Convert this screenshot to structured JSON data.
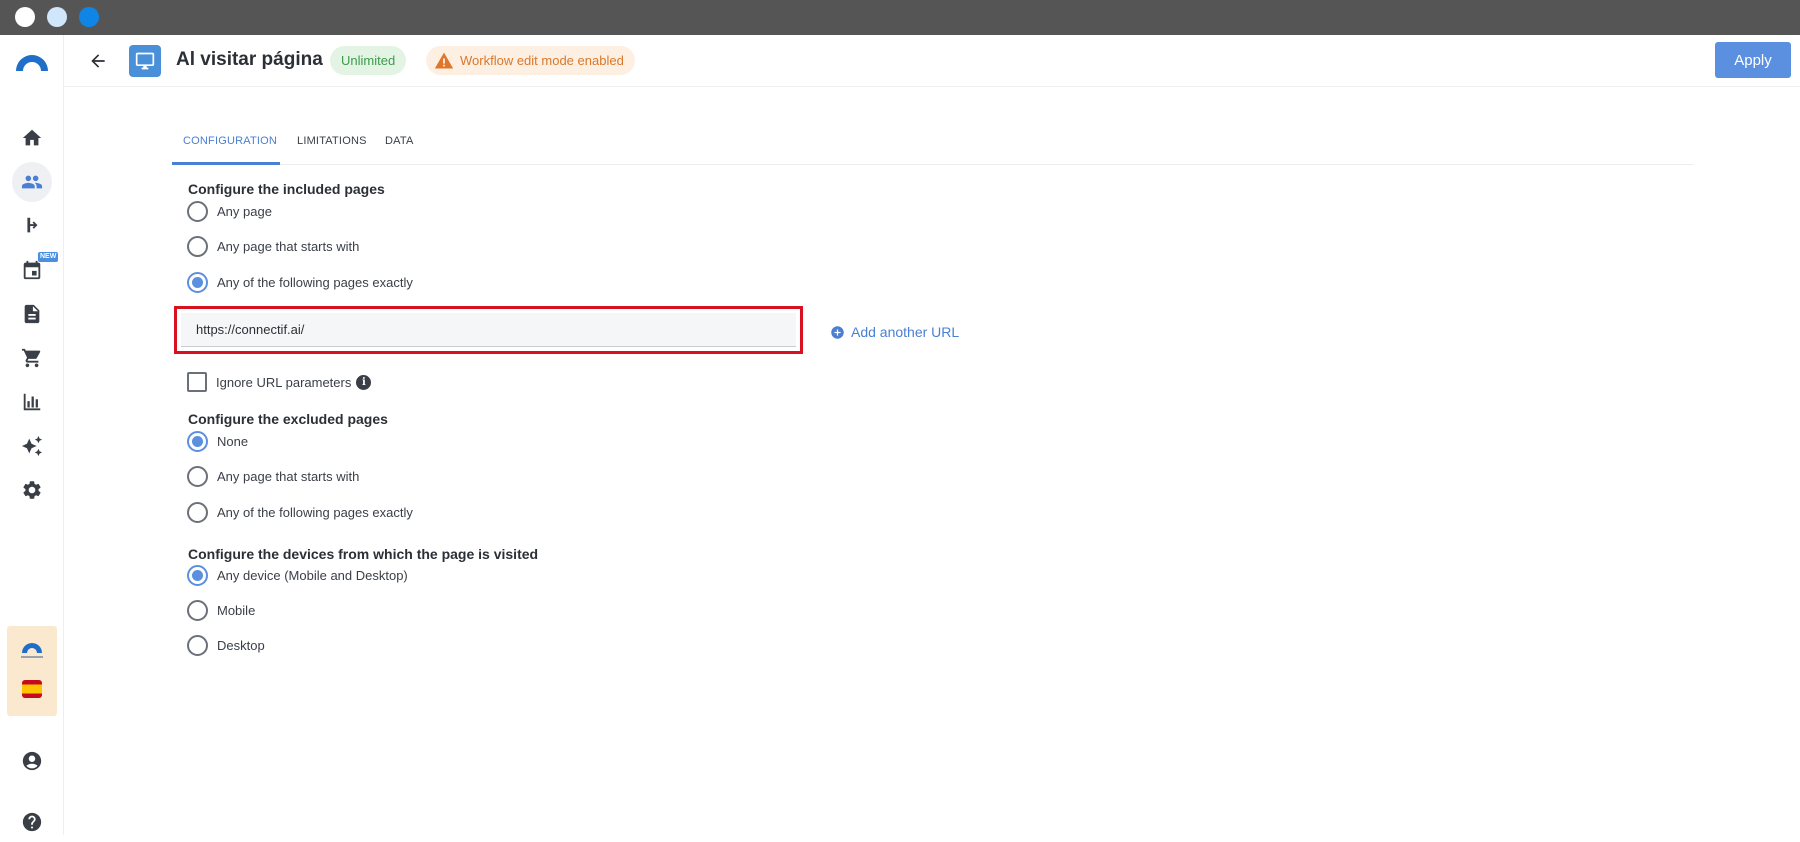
{
  "window": {
    "controls": [
      "close",
      "minimize",
      "maximize"
    ]
  },
  "sidebar": {
    "logo": "connectif-logo",
    "items": [
      {
        "icon": "home-icon"
      },
      {
        "icon": "contacts-icon",
        "active": true
      },
      {
        "icon": "workflow-icon"
      },
      {
        "icon": "calendar-icon",
        "badge": "NEW"
      },
      {
        "icon": "document-icon"
      },
      {
        "icon": "cart-icon"
      },
      {
        "icon": "bar-chart-icon"
      },
      {
        "icon": "sparkles-icon"
      },
      {
        "icon": "gear-icon"
      }
    ],
    "account": {
      "flag": "spain-flag"
    },
    "bottom": [
      {
        "icon": "user-icon"
      },
      {
        "icon": "help-icon"
      }
    ]
  },
  "header": {
    "title": "Al visitar página",
    "badge_limit": "Unlimited",
    "badge_warning": "Workflow edit mode enabled",
    "apply_label": "Apply"
  },
  "tabs": [
    {
      "label": "CONFIGURATION",
      "active": true
    },
    {
      "label": "LIMITATIONS",
      "active": false
    },
    {
      "label": "DATA",
      "active": false
    }
  ],
  "included": {
    "title": "Configure the included pages",
    "options": [
      {
        "label": "Any page",
        "checked": false
      },
      {
        "label": "Any page that starts with",
        "checked": false
      },
      {
        "label": "Any of the following pages exactly",
        "checked": true
      }
    ],
    "url_value": "https://connectif.ai/",
    "add_url_label": "Add another URL",
    "ignore_params_label": "Ignore URL parameters",
    "ignore_params_checked": false
  },
  "excluded": {
    "title": "Configure the excluded pages",
    "options": [
      {
        "label": "None",
        "checked": true
      },
      {
        "label": "Any page that starts with",
        "checked": false
      },
      {
        "label": "Any of the following pages exactly",
        "checked": false
      }
    ]
  },
  "devices": {
    "title": "Configure the devices from which the page is visited",
    "options": [
      {
        "label": "Any device (Mobile and Desktop)",
        "checked": true
      },
      {
        "label": "Mobile",
        "checked": false
      },
      {
        "label": "Desktop",
        "checked": false
      }
    ]
  },
  "colors": {
    "accent": "#5b8fe0",
    "titlebar": "#555555",
    "highlight_border": "#d7111d",
    "success_badge_bg": "#e3f4e4",
    "warning_badge_bg": "#fdf0e3"
  }
}
